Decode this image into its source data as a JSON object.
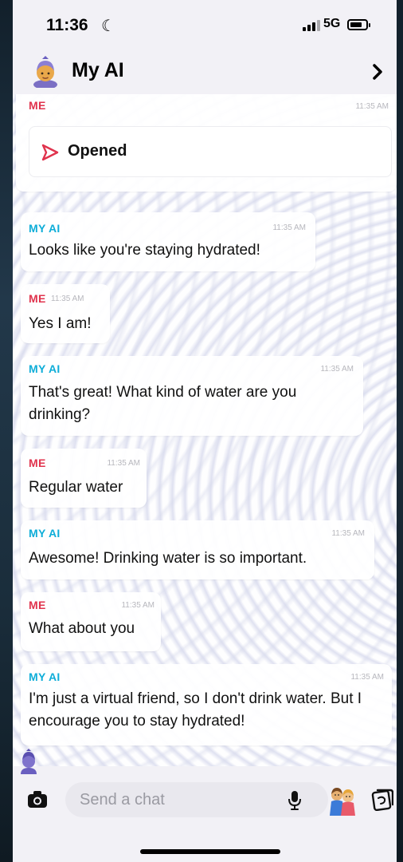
{
  "status_bar": {
    "time": "11:36",
    "network": "5G"
  },
  "header": {
    "title": "My AI"
  },
  "messages": [
    {
      "sender": "ME",
      "time": "11:35 AM",
      "text": "Opened"
    },
    {
      "sender": "MY AI",
      "time": "11:35 AM",
      "text": "Looks like you're staying hydrated!"
    },
    {
      "sender": "ME",
      "time": "11:35 AM",
      "text": "Yes I am!"
    },
    {
      "sender": "MY AI",
      "time": "11:35 AM",
      "text": "That's great! What kind of water are you drinking?"
    },
    {
      "sender": "ME",
      "time": "11:35 AM",
      "text": "Regular water"
    },
    {
      "sender": "MY AI",
      "time": "11:35 AM",
      "text": "Awesome! Drinking water is so important."
    },
    {
      "sender": "ME",
      "time": "11:35 AM",
      "text": "What about you"
    },
    {
      "sender": "MY AI",
      "time": "11:35 AM",
      "text": "I'm just a virtual friend, so I don't drink water. But I encourage you to stay hydrated!"
    }
  ],
  "composer": {
    "placeholder": "Send a chat"
  },
  "colors": {
    "me": "#e0334d",
    "ai": "#0eadd8",
    "opened_icon": "#e0334d"
  },
  "icons": [
    "moon-icon",
    "signal-icon",
    "battery-icon",
    "chevron-right-icon",
    "camera-icon",
    "mic-icon",
    "bitmoji-icon",
    "cards-icon",
    "opened-arrow-icon"
  ]
}
